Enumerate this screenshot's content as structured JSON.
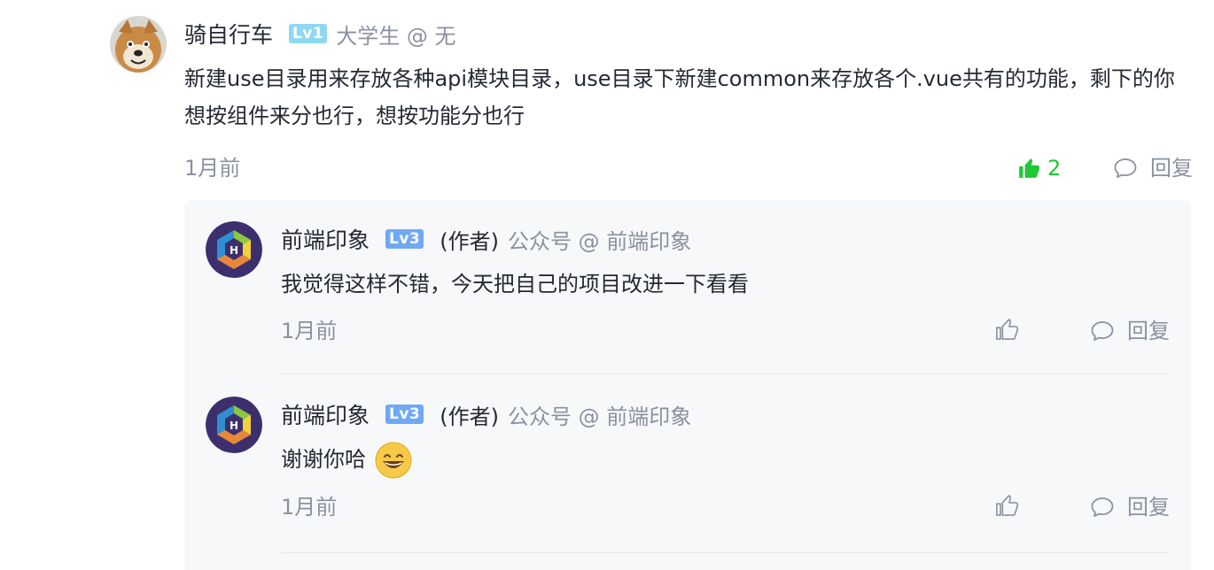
{
  "main_comment": {
    "username": "骑自行车",
    "level": "Lv1",
    "job": "大学生 @ 无",
    "content": "新建use目录用来存放各种api模块目录，use目录下新建common来存放各个.vue共有的功能，剩下的你想按组件来分也行，想按功能分也行",
    "time": "1月前",
    "like_count": "2",
    "reply_label": "回复",
    "liked": true
  },
  "replies": [
    {
      "username": "前端印象",
      "level": "Lv3",
      "author_tag": "(作者)",
      "job": "公众号 @ 前端印象",
      "content": "我觉得这样不错，今天把自己的项目改进一下看看",
      "time": "1月前",
      "reply_label": "回复"
    },
    {
      "username": "前端印象",
      "level": "Lv3",
      "author_tag": "(作者)",
      "job": "公众号 @ 前端印象",
      "content": "谢谢你哈",
      "time": "1月前",
      "reply_label": "回复"
    }
  ],
  "colors": {
    "text": "#252933",
    "muted": "#8a919f",
    "like_active": "#1ec934",
    "sub_bg": "#f7f8fa",
    "lv1": "#8fd8f2",
    "lv3": "#6fa9f5"
  },
  "icons": [
    "dog-avatar",
    "hexagon-logo-avatar",
    "thumbs-up-icon",
    "comment-bubble-icon",
    "grinning-emoji-icon"
  ]
}
